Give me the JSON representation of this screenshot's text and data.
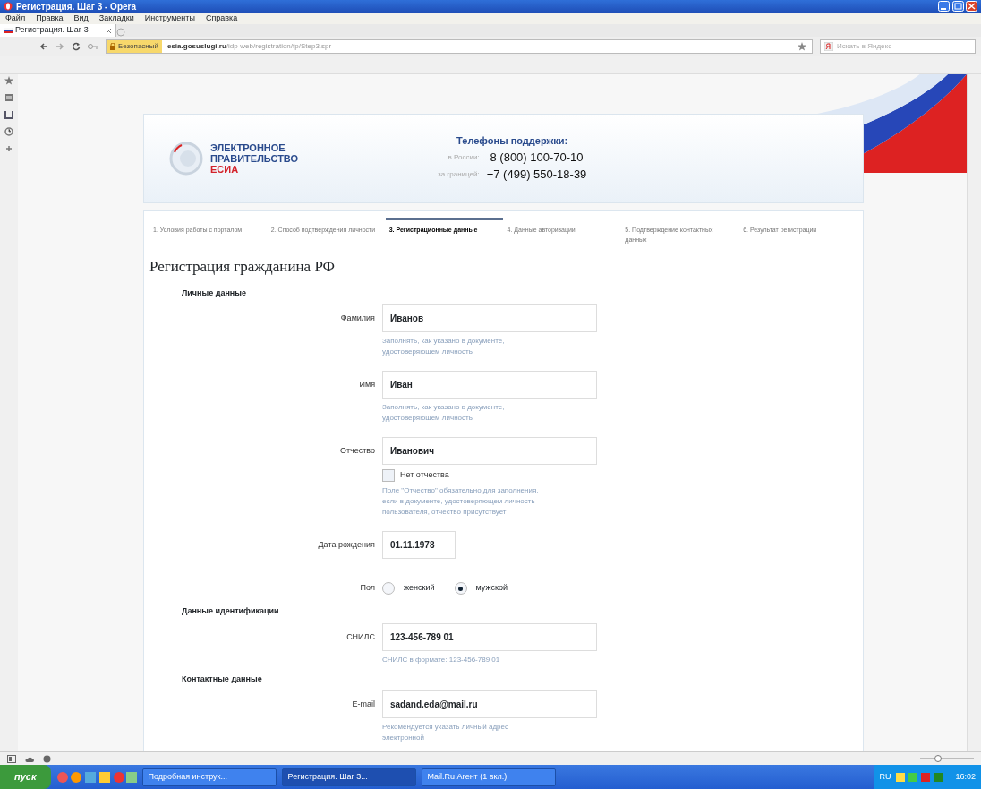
{
  "window": {
    "title": "Регистрация. Шаг 3 - Opera"
  },
  "menu": [
    "Файл",
    "Правка",
    "Вид",
    "Закладки",
    "Инструменты",
    "Справка"
  ],
  "tabs": [
    {
      "label": "Регистрация. Шаг 3",
      "selected": true
    }
  ],
  "address_bar": {
    "security_badge": "Безопасный",
    "url_host": "esia.gosuslugi.ru",
    "url_path": "/idp-web/registration/fp/Step3.spr"
  },
  "search": {
    "placeholder": "Искать в Яндекс"
  },
  "header": {
    "logo_lines": [
      "ЭЛЕКТРОННОЕ",
      "ПРАВИТЕЛЬСТВО",
      "ЕСИА"
    ],
    "support_title": "Телефоны поддержки:",
    "phones": [
      {
        "label": "в России:",
        "number": "8 (800) 100-70-10"
      },
      {
        "label": "за границей:",
        "number": "+7 (499) 550-18-39"
      }
    ]
  },
  "steps": [
    {
      "label": "1. Условия работы с порталом",
      "selected": false
    },
    {
      "label": "2. Способ подтверждения личности",
      "selected": false
    },
    {
      "label": "3. Регистрационные данные",
      "selected": true
    },
    {
      "label": "4. Данные авторизации",
      "selected": false
    },
    {
      "label": "5. Подтверждение контактных данных",
      "selected": false
    },
    {
      "label": "6. Результат регистрации",
      "selected": false
    }
  ],
  "form": {
    "title": "Регистрация гражданина РФ",
    "sections": [
      {
        "title": "Личные данные",
        "fields": [
          {
            "kind": "text",
            "label": "Фамилия",
            "value": "Иванов",
            "hint": "Заполнять, как указано в документе, удостоверяющем личность"
          },
          {
            "kind": "text",
            "label": "Имя",
            "value": "Иван",
            "hint": "Заполнять, как указано в документе, удостоверяющем личность"
          },
          {
            "kind": "text",
            "label": "Отчество",
            "value": "Иванович",
            "checkbox": {
              "label": "Нет отчества",
              "checked": false
            },
            "hint": "Поле \"Отчество\" обязательно для заполнения, если в документе, удостоверяющем личность пользователя, отчество присутствует"
          },
          {
            "kind": "date",
            "label": "Дата рождения",
            "value": "01.11.1978"
          },
          {
            "kind": "radio",
            "label": "Пол",
            "options": [
              {
                "label": "женский",
                "selected": false
              },
              {
                "label": "мужской",
                "selected": true
              }
            ]
          }
        ]
      },
      {
        "title": "Данные идентификации",
        "fields": [
          {
            "kind": "text",
            "label": "СНИЛС",
            "value": "123-456-789 01",
            "hint": "СНИЛС в формате: 123-456-789 01"
          }
        ]
      },
      {
        "title": "Контактные данные",
        "fields": [
          {
            "kind": "text",
            "label": "E-mail",
            "value": "sadand.eda@mail.ru",
            "hint": "Рекомендуется указать личный адрес электронной"
          }
        ]
      }
    ]
  },
  "taskbar": {
    "start": "пуск",
    "tasks": [
      {
        "label": "Подробная инструк...",
        "selected": false
      },
      {
        "label": "Регистрация. Шаг 3...",
        "selected": true
      },
      {
        "label": "Mail.Ru Агент (1 вкл.)",
        "selected": false
      }
    ],
    "language": "RU",
    "clock": "16:02"
  }
}
